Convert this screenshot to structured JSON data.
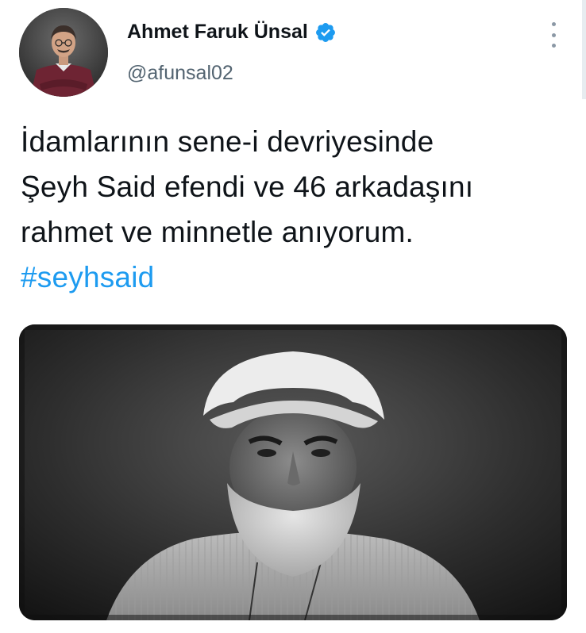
{
  "author": {
    "display_name": "Ahmet Faruk Ünsal",
    "handle": "@afunsal02",
    "verified": true,
    "avatar_icon": "profile-photo"
  },
  "tweet": {
    "lines": [
      "İdamlarının sene-i devriyesinde",
      "Şeyh Said efendi ve 46 arkadaşını",
      "rahmet ve minnetle anıyorum."
    ],
    "hashtag": "#seyhsaid"
  },
  "media": {
    "type": "photo",
    "icon": "portrait-photo"
  },
  "colors": {
    "accent": "#1d9bf0",
    "text": "#0f1419",
    "secondary": "#536471"
  }
}
